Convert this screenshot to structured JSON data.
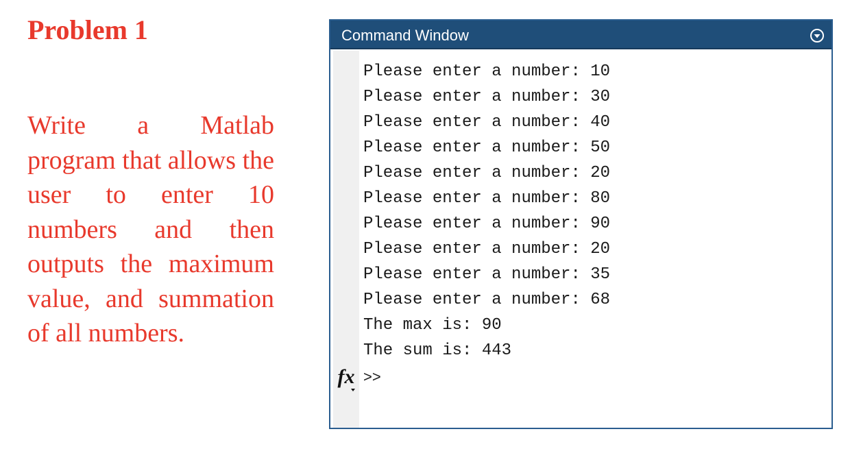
{
  "problem": {
    "title": "Problem 1",
    "text": "Write a Matlab program that allows the user to enter 10 numbers and then outputs the maximum value, and summation of all numbers."
  },
  "command_window": {
    "title": "Command Window",
    "menu_icon": "circle-chevron-down-icon",
    "output_lines": [
      "Please enter a number: 10",
      "Please enter a number: 30",
      "Please enter a number: 40",
      "Please enter a number: 50",
      "Please enter a number: 20",
      "Please enter a number: 80",
      "Please enter a number: 90",
      "Please enter a number: 20",
      "Please enter a number: 35",
      "Please enter a number: 68",
      "The max is: 90",
      "The sum is: 443"
    ],
    "fx_label": "fx",
    "prompt": ">>",
    "input_value": ""
  },
  "colors": {
    "problem_text": "#e8392c",
    "header_bg": "#1f4e79",
    "gutter_bg": "#f0f0f0"
  }
}
